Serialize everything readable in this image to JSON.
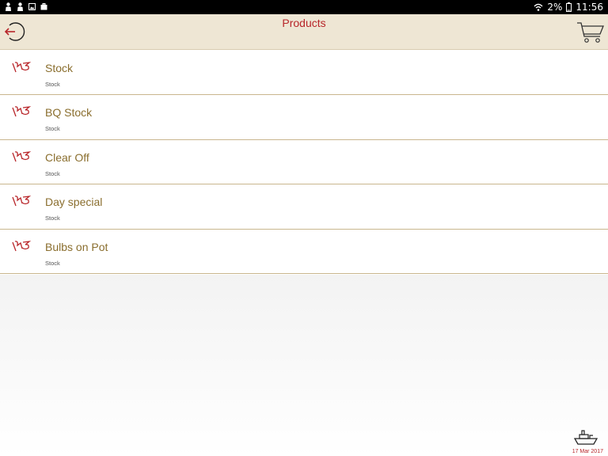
{
  "status_bar": {
    "left_icons": [
      "person-icon",
      "person-icon",
      "image-icon",
      "briefcase-icon"
    ],
    "battery": "2%",
    "time": "11:56"
  },
  "header": {
    "title": "Products",
    "back_icon": "back-arrow-icon",
    "cart_icon": "cart-icon"
  },
  "products": [
    {
      "title": "Stock",
      "subtitle": "Stock"
    },
    {
      "title": "BQ Stock",
      "subtitle": "Stock"
    },
    {
      "title": "Clear Off",
      "subtitle": "Stock"
    },
    {
      "title": "Day special",
      "subtitle": "Stock"
    },
    {
      "title": "Bulbs on Pot",
      "subtitle": "Stock"
    }
  ],
  "footer": {
    "icon": "ship-icon",
    "date": "17 Mar 2017"
  },
  "colors": {
    "header_bg": "#eee6d4",
    "accent_red": "#b8262a",
    "item_text": "#8a6e2e",
    "divider": "#c9b68e"
  }
}
